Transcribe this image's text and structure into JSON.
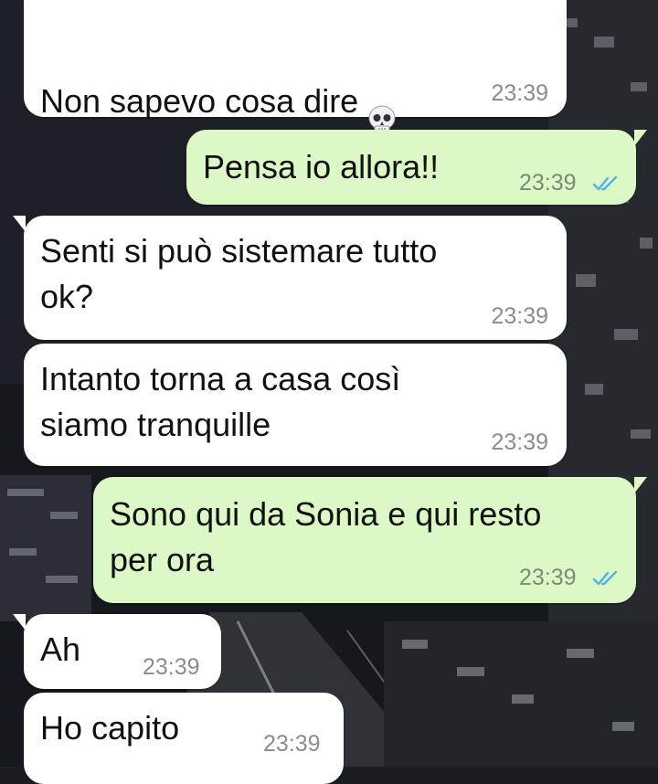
{
  "messages": [
    {
      "id": "m1",
      "direction": "incoming",
      "text": "Non sapevo cosa dire",
      "emoji": "skull-emoji",
      "time": "23:39"
    },
    {
      "id": "m2",
      "direction": "outgoing",
      "text": "Pensa io allora!!",
      "time": "23:39",
      "status": "read"
    },
    {
      "id": "m3",
      "direction": "incoming",
      "text": "Senti si può sistemare tutto\nok?",
      "time": "23:39"
    },
    {
      "id": "m4",
      "direction": "incoming",
      "text": "Intanto torna a casa così\nsiamo tranquille",
      "time": "23:39"
    },
    {
      "id": "m5",
      "direction": "outgoing",
      "text": "Sono qui da Sonia e qui resto\nper ora",
      "time": "23:39",
      "status": "read"
    },
    {
      "id": "m6",
      "direction": "incoming",
      "text": "Ah",
      "time": "23:39"
    },
    {
      "id": "m7",
      "direction": "incoming",
      "text": "Ho capito",
      "time": "23:39"
    }
  ],
  "colors": {
    "incoming_bubble": "#ffffff",
    "outgoing_bubble": "#dcf8c6",
    "read_ticks": "#4fb3e8",
    "timestamp": "#8c8c8c"
  },
  "icons": {
    "read_receipt": "double-check-icon",
    "emoji": "skull-emoji"
  }
}
